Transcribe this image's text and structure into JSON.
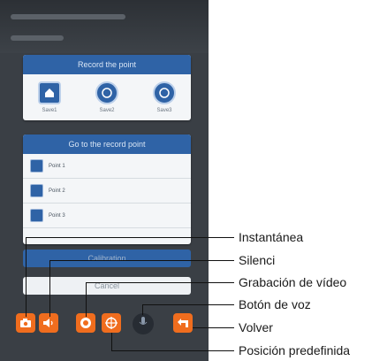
{
  "record_panel": {
    "title": "Record the point",
    "slots": [
      {
        "label": "Save1",
        "icon": "home-icon"
      },
      {
        "label": "Save2",
        "icon": "slot-2-icon"
      },
      {
        "label": "Save3",
        "icon": "slot-3-icon"
      }
    ]
  },
  "goto_panel": {
    "title": "Go to the record point",
    "items": [
      {
        "label": "Point 1"
      },
      {
        "label": "Point 2"
      },
      {
        "label": "Point 3"
      }
    ]
  },
  "buttons": {
    "calibration": "Calibration",
    "cancel": "Cancel"
  },
  "toolbar": {
    "items": [
      {
        "name": "snapshot",
        "icon": "camera-icon"
      },
      {
        "name": "mute",
        "icon": "speaker-icon"
      },
      {
        "name": "record",
        "icon": "record-icon"
      },
      {
        "name": "preset",
        "icon": "crosshair-icon"
      },
      {
        "name": "voice",
        "icon": "microphone-icon"
      },
      {
        "name": "back",
        "icon": "back-arrow-icon"
      }
    ]
  },
  "callouts": {
    "snapshot": "Instantánea",
    "mute": "Silenci",
    "record": "Grabación de vídeo",
    "voice": "Botón de voz",
    "back": "Volver",
    "preset": "Posición predefinida"
  },
  "colors": {
    "panel_blue": "#2f63a6",
    "toolbar_orange": "#f06d1e",
    "background_dark": "#3a3f45"
  }
}
